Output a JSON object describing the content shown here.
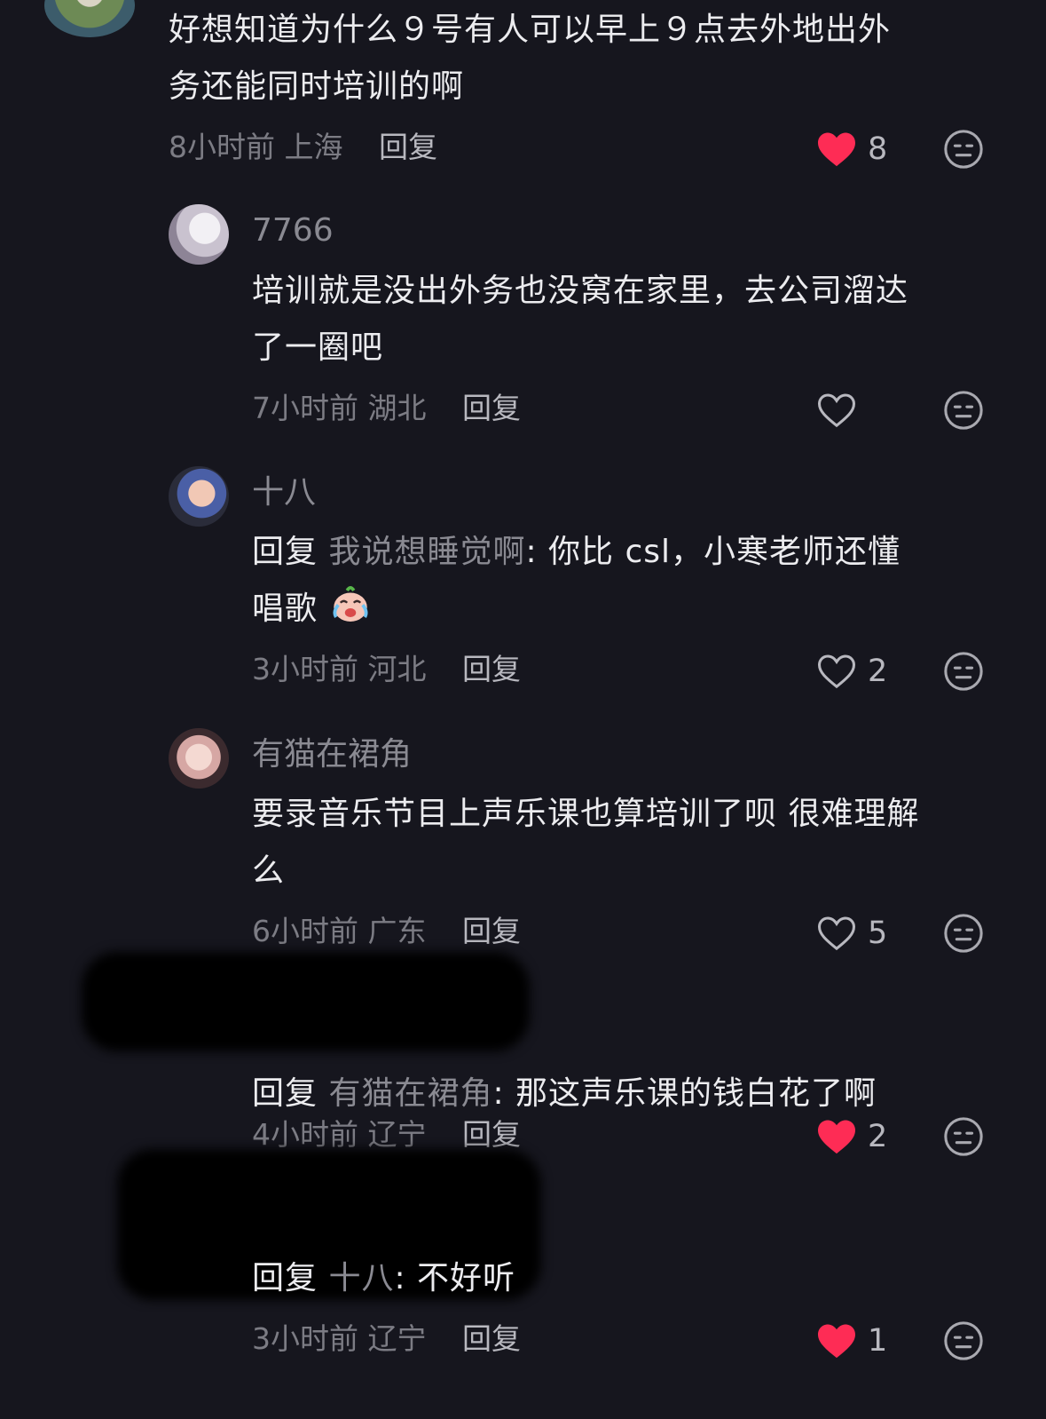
{
  "comments": [
    {
      "text": "好想知道为什么９号有人可以早上９点去外地出外务还能同时培训的啊",
      "line1": "好想知道为什么９号有人可以早上９点去外地出外",
      "line2": "务还能同时培训的啊",
      "time": "8小时前",
      "location": "上海",
      "reply_label": "回复",
      "likes": "8",
      "liked": true
    },
    {
      "username": "7766",
      "line1": "培训就是没出外务也没窝在家里，去公司溜达",
      "line2": "了一圈吧",
      "time": "7小时前",
      "location": "湖北",
      "reply_label": "回复",
      "likes": "",
      "liked": false
    },
    {
      "username": "十八",
      "reply_prefix": "回复",
      "reply_to": "我说想睡觉啊",
      "line1_rest": ": 你比 csl，小寒老师还懂",
      "line2": "唱歌",
      "emoji": "crying-laughing-emoji",
      "time": "3小时前",
      "location": "河北",
      "reply_label": "回复",
      "likes": "2",
      "liked": false
    },
    {
      "username": "有猫在裙角",
      "line1": "要录音乐节目上声乐课也算培训了呗 很难理解",
      "line2": "么",
      "time": "6小时前",
      "location": "广东",
      "reply_label": "回复",
      "likes": "5",
      "liked": false
    },
    {
      "reply_prefix": "回复",
      "reply_to": "有猫在裙角",
      "line1_rest": ": 那这声乐课的钱白花了啊",
      "time": "4小时前",
      "location": "辽宁",
      "reply_label": "回复",
      "likes": "2",
      "liked": true
    },
    {
      "reply_prefix": "回复",
      "reply_to": "十八",
      "line1_rest": ": 不好听",
      "time": "3小时前",
      "location": "辽宁",
      "reply_label": "回复",
      "likes": "1",
      "liked": true
    }
  ],
  "colors": {
    "background": "#16161e",
    "liked_heart": "#fe2c55",
    "muted_text": "#8a8a92"
  }
}
